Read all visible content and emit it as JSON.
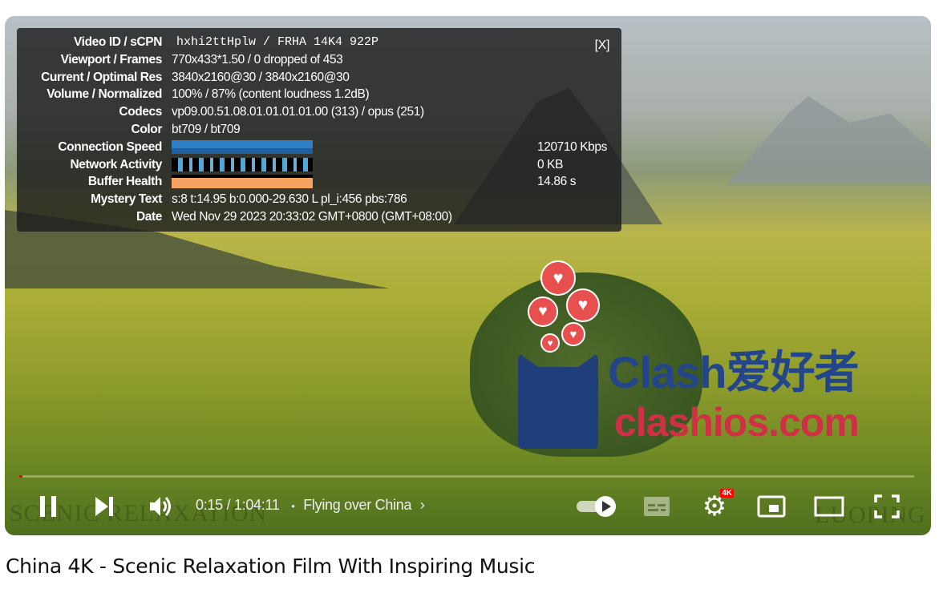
{
  "stats": {
    "close_label": "[X]",
    "rows": [
      {
        "label": "Video ID / sCPN",
        "value": "hxhi2ttHplw / FRHA 14K4 922P"
      },
      {
        "label": "Viewport / Frames",
        "value": "770x433*1.50 / 0 dropped of 453"
      },
      {
        "label": "Current / Optimal Res",
        "value": "3840x2160@30 / 3840x2160@30"
      },
      {
        "label": "Volume / Normalized",
        "value": "100% / 87% (content loudness 1.2dB)"
      },
      {
        "label": "Codecs",
        "value": "vp09.00.51.08.01.01.01.01.00 (313) / opus (251)"
      },
      {
        "label": "Color",
        "value": "bt709 / bt709"
      },
      {
        "label": "Connection Speed",
        "value": "120710 Kbps"
      },
      {
        "label": "Network Activity",
        "value": "0 KB"
      },
      {
        "label": "Buffer Health",
        "value": "14.86 s"
      },
      {
        "label": "Mystery Text",
        "value": "s:8 t:14.95 b:0.000-29.630 L pl_i:456 pbs:786"
      },
      {
        "label": "Date",
        "value": "Wed Nov 29 2023 20:33:02 GMT+0800 (GMT+08:00)"
      }
    ],
    "colors": {
      "connection": "#2f7fc4",
      "network": "#4fa8d8",
      "buffer": "#f4a460"
    }
  },
  "overlay": {
    "logo_line1": "Clash爱好者",
    "logo_line2": "clashios.com"
  },
  "watermarks": {
    "left": "SCENIC RELAXATION",
    "right": "LUOPING"
  },
  "player": {
    "progress_percent": 0.4,
    "time": "0:15 / 1:04:11",
    "chapter_separator": "•",
    "chapter": "Flying over China",
    "quality_badge": "4K",
    "accent": "#ff0000"
  },
  "video_title": "China 4K - Scenic Relaxation Film With Inspiring Music"
}
